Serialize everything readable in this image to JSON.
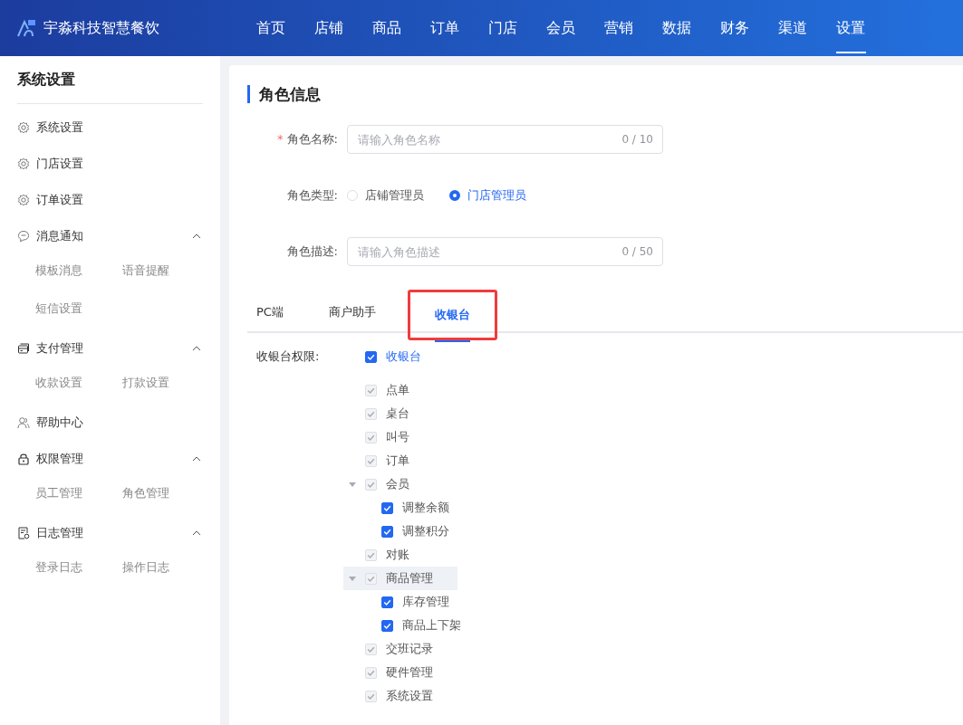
{
  "header": {
    "brand": "宇淼科技智慧餐饮",
    "nav": [
      {
        "label": "首页",
        "selected": false
      },
      {
        "label": "店铺",
        "selected": false
      },
      {
        "label": "商品",
        "selected": false
      },
      {
        "label": "订单",
        "selected": false
      },
      {
        "label": "门店",
        "selected": false
      },
      {
        "label": "会员",
        "selected": false
      },
      {
        "label": "营销",
        "selected": false
      },
      {
        "label": "数据",
        "selected": false
      },
      {
        "label": "财务",
        "selected": false
      },
      {
        "label": "渠道",
        "selected": false
      },
      {
        "label": "设置",
        "selected": true
      }
    ]
  },
  "sidebar": {
    "title": "系统设置",
    "items": [
      {
        "label": "系统设置",
        "kind": "gear"
      },
      {
        "label": "门店设置",
        "kind": "gear"
      },
      {
        "label": "订单设置",
        "kind": "gear"
      },
      {
        "label": "消息通知",
        "kind": "chat",
        "expanded": true,
        "children": [
          "模板消息",
          "语音提醒",
          "短信设置"
        ]
      },
      {
        "label": "支付管理",
        "kind": "card",
        "expanded": true,
        "children": [
          "收款设置",
          "打款设置"
        ]
      },
      {
        "label": "帮助中心",
        "kind": "user"
      },
      {
        "label": "权限管理",
        "kind": "lock",
        "expanded": true,
        "children": [
          "员工管理",
          "角色管理"
        ]
      },
      {
        "label": "日志管理",
        "kind": "log",
        "expanded": true,
        "children": [
          "登录日志",
          "操作日志"
        ]
      }
    ]
  },
  "main": {
    "title": "角色信息",
    "form": [
      {
        "kind": "input",
        "required_mark": "*",
        "label": "角色名称:",
        "placeholder": "请输入角色名称",
        "counter": "0 / 10"
      },
      {
        "kind": "radio",
        "label": "角色类型:",
        "options": [
          {
            "label": "店铺管理员",
            "selected": false
          },
          {
            "label": "门店管理员",
            "selected": true
          }
        ]
      },
      {
        "kind": "input",
        "label": "角色描述:",
        "placeholder": "请输入角色描述",
        "counter": "0 / 50"
      }
    ],
    "tabs": [
      {
        "label": "PC端",
        "selected": false,
        "highlighted": false
      },
      {
        "label": "商户助手",
        "selected": false,
        "highlighted": false
      },
      {
        "label": "收银台",
        "selected": true,
        "highlighted": true
      }
    ],
    "permissions": {
      "label": "收银台权限:",
      "tree": [
        {
          "label": "收银台",
          "checked": true,
          "disabled": false,
          "children": [
            {
              "label": "点单",
              "checked": true,
              "disabled": true,
              "hovered": false
            },
            {
              "label": "桌台",
              "checked": true,
              "disabled": true,
              "hovered": false
            },
            {
              "label": "叫号",
              "checked": true,
              "disabled": true,
              "hovered": false
            },
            {
              "label": "订单",
              "checked": true,
              "disabled": true,
              "hovered": false
            },
            {
              "label": "会员",
              "checked": true,
              "disabled": true,
              "hovered": false,
              "expanded": true,
              "children": [
                {
                  "label": "调整余额",
                  "checked": true,
                  "disabled": false
                },
                {
                  "label": "调整积分",
                  "checked": true,
                  "disabled": false
                }
              ]
            },
            {
              "label": "对账",
              "checked": true,
              "disabled": true,
              "hovered": false
            },
            {
              "label": "商品管理",
              "checked": true,
              "disabled": true,
              "hovered": true,
              "expanded": true,
              "children": [
                {
                  "label": "库存管理",
                  "checked": true,
                  "disabled": false
                },
                {
                  "label": "商品上下架",
                  "checked": true,
                  "disabled": false
                }
              ]
            },
            {
              "label": "交班记录",
              "checked": true,
              "disabled": true,
              "hovered": false
            },
            {
              "label": "硬件管理",
              "checked": true,
              "disabled": true,
              "hovered": false
            },
            {
              "label": "系统设置",
              "checked": true,
              "disabled": true,
              "hovered": false
            }
          ]
        }
      ]
    }
  }
}
